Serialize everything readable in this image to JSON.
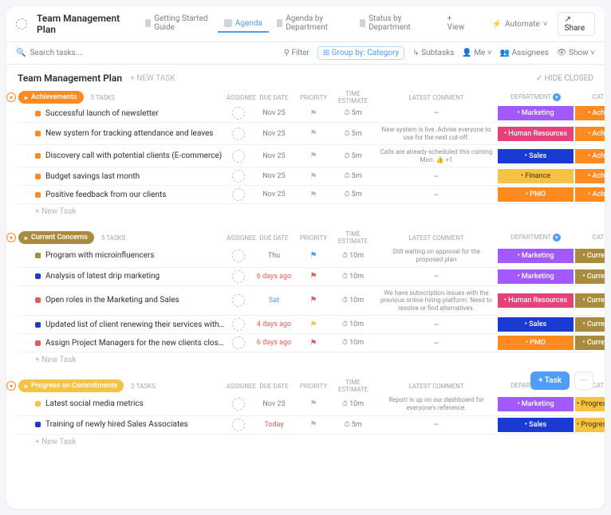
{
  "header": {
    "title": "Team Management Plan",
    "views": [
      {
        "label": "Getting Started Guide",
        "active": false
      },
      {
        "label": "Agenda",
        "active": true
      },
      {
        "label": "Agenda by Department",
        "active": false
      },
      {
        "label": "Status by Department",
        "active": false
      }
    ],
    "add_view": "+ View",
    "automate": "Automate",
    "share": "Share"
  },
  "toolbar": {
    "search_placeholder": "Search tasks...",
    "filter": "Filter",
    "group_by": "Group by: Category",
    "subtasks": "Subtasks",
    "me": "Me",
    "assignees": "Assignees",
    "show": "Show"
  },
  "list": {
    "title": "Team Management Plan",
    "new_task": "+ NEW TASK",
    "hide_closed": "HIDE CLOSED",
    "columns": [
      "ASSIGNEE",
      "DUE DATE",
      "PRIORITY",
      "TIME ESTIMATE",
      "LATEST COMMENT",
      "DEPARTMENT",
      "CATEGORY"
    ]
  },
  "groups": [
    {
      "name": "Achievements",
      "color": "#ff8a1f",
      "count": "5 TASKS",
      "tasks": [
        {
          "name": "Successful launch of newsletter",
          "color": "#ff8a1f",
          "due": "Nov 25",
          "dueClass": "",
          "pri": "🏳️",
          "priColor": "#bbb",
          "est": "5m",
          "comment": "–",
          "dept": "Marketing",
          "cat": "Achievements"
        },
        {
          "name": "New system for tracking attendance and leaves",
          "color": "#ff8a1f",
          "due": "Nov 25",
          "dueClass": "",
          "pri": "🏳️",
          "priColor": "#bbb",
          "est": "5m",
          "comment": "New system is live. Advise everyone to use for the next cut-off.",
          "dept": "Human Resources",
          "cat": "Achievements"
        },
        {
          "name": "Discovery call with potential clients (E-commerce)",
          "color": "#ff8a1f",
          "due": "Nov 25",
          "dueClass": "",
          "pri": "🏳️",
          "priColor": "#bbb",
          "est": "5m",
          "comment": "Calls are already scheduled this coming Mon. 👍 +1",
          "dept": "Sales",
          "cat": "Achievements"
        },
        {
          "name": "Budget savings last month",
          "color": "#ff8a1f",
          "due": "Nov 25",
          "dueClass": "",
          "pri": "🏳️",
          "priColor": "#bbb",
          "est": "5m",
          "comment": "–",
          "dept": "Finance",
          "cat": "Achievements"
        },
        {
          "name": "Positive feedback from our clients",
          "color": "#ff8a1f",
          "due": "Nov 25",
          "dueClass": "",
          "pri": "🏳️",
          "priColor": "#bbb",
          "est": "5m",
          "comment": "–",
          "dept": "PMO",
          "cat": "Achievements"
        }
      ]
    },
    {
      "name": "Current Concerns",
      "color": "#a88b3d",
      "count": "5 TASKS",
      "tasks": [
        {
          "name": "Program with microinfluencers",
          "color": "#a88b3d",
          "due": "Thu",
          "dueClass": "",
          "pri": "🏳️",
          "priColor": "#4f9cf9",
          "est": "10m",
          "comment": "Still waiting on approval for the proposed plan",
          "dept": "Marketing",
          "cat": "Current Concerns"
        },
        {
          "name": "Analysis of latest drip marketing",
          "color": "#1a3bd1",
          "due": "6 days ago",
          "dueClass": "red",
          "pri": "🏳️",
          "priColor": "#e05d5d",
          "est": "10m",
          "comment": "–",
          "dept": "Marketing",
          "cat": "Current Concerns"
        },
        {
          "name": "Open roles in the Marketing and Sales",
          "color": "#e05d5d",
          "due": "Sat",
          "dueClass": "blue",
          "pri": "🏳️",
          "priColor": "#e05d5d",
          "est": "10m",
          "comment": "We have subscription issues with the previous online hiring platform. Need to resolve or find alternatives.",
          "dept": "Human Resources",
          "cat": "Current Concerns"
        },
        {
          "name": "Updated list of client renewing their services with the company",
          "color": "#1a3bd1",
          "due": "4 days ago",
          "dueClass": "red",
          "pri": "🏳️",
          "priColor": "#f5c343",
          "est": "10m",
          "comment": "–",
          "dept": "Sales",
          "cat": "Current Concerns"
        },
        {
          "name": "Assign Project Managers for the new clients closed last week",
          "color": "#e05d5d",
          "due": "6 days ago",
          "dueClass": "red",
          "pri": "🏳️",
          "priColor": "#e05d5d",
          "est": "10m",
          "comment": "–",
          "dept": "PMO",
          "cat": "Current Concerns"
        }
      ]
    },
    {
      "name": "Progress on Commitments",
      "color": "#f5c343",
      "count": "2 TASKS",
      "tasks": [
        {
          "name": "Latest social media metrics",
          "color": "#f5c343",
          "due": "Nov 25",
          "dueClass": "",
          "pri": "🏳️",
          "priColor": "#bbb",
          "est": "10m",
          "comment": "Report is up on our dashboard for everyone's reference.",
          "dept": "Marketing",
          "cat": "Progress on Commit..."
        },
        {
          "name": "Training of newly hired Sales Associates",
          "color": "#1a3bd1",
          "due": "Today",
          "dueClass": "red",
          "pri": "🏳️",
          "priColor": "#bbb",
          "est": "5m",
          "comment": "–",
          "dept": "Sales",
          "cat": "Progress on Commit..."
        }
      ]
    }
  ],
  "misc": {
    "new_task_row": "+ New Task",
    "fab_task": "+ Task"
  }
}
